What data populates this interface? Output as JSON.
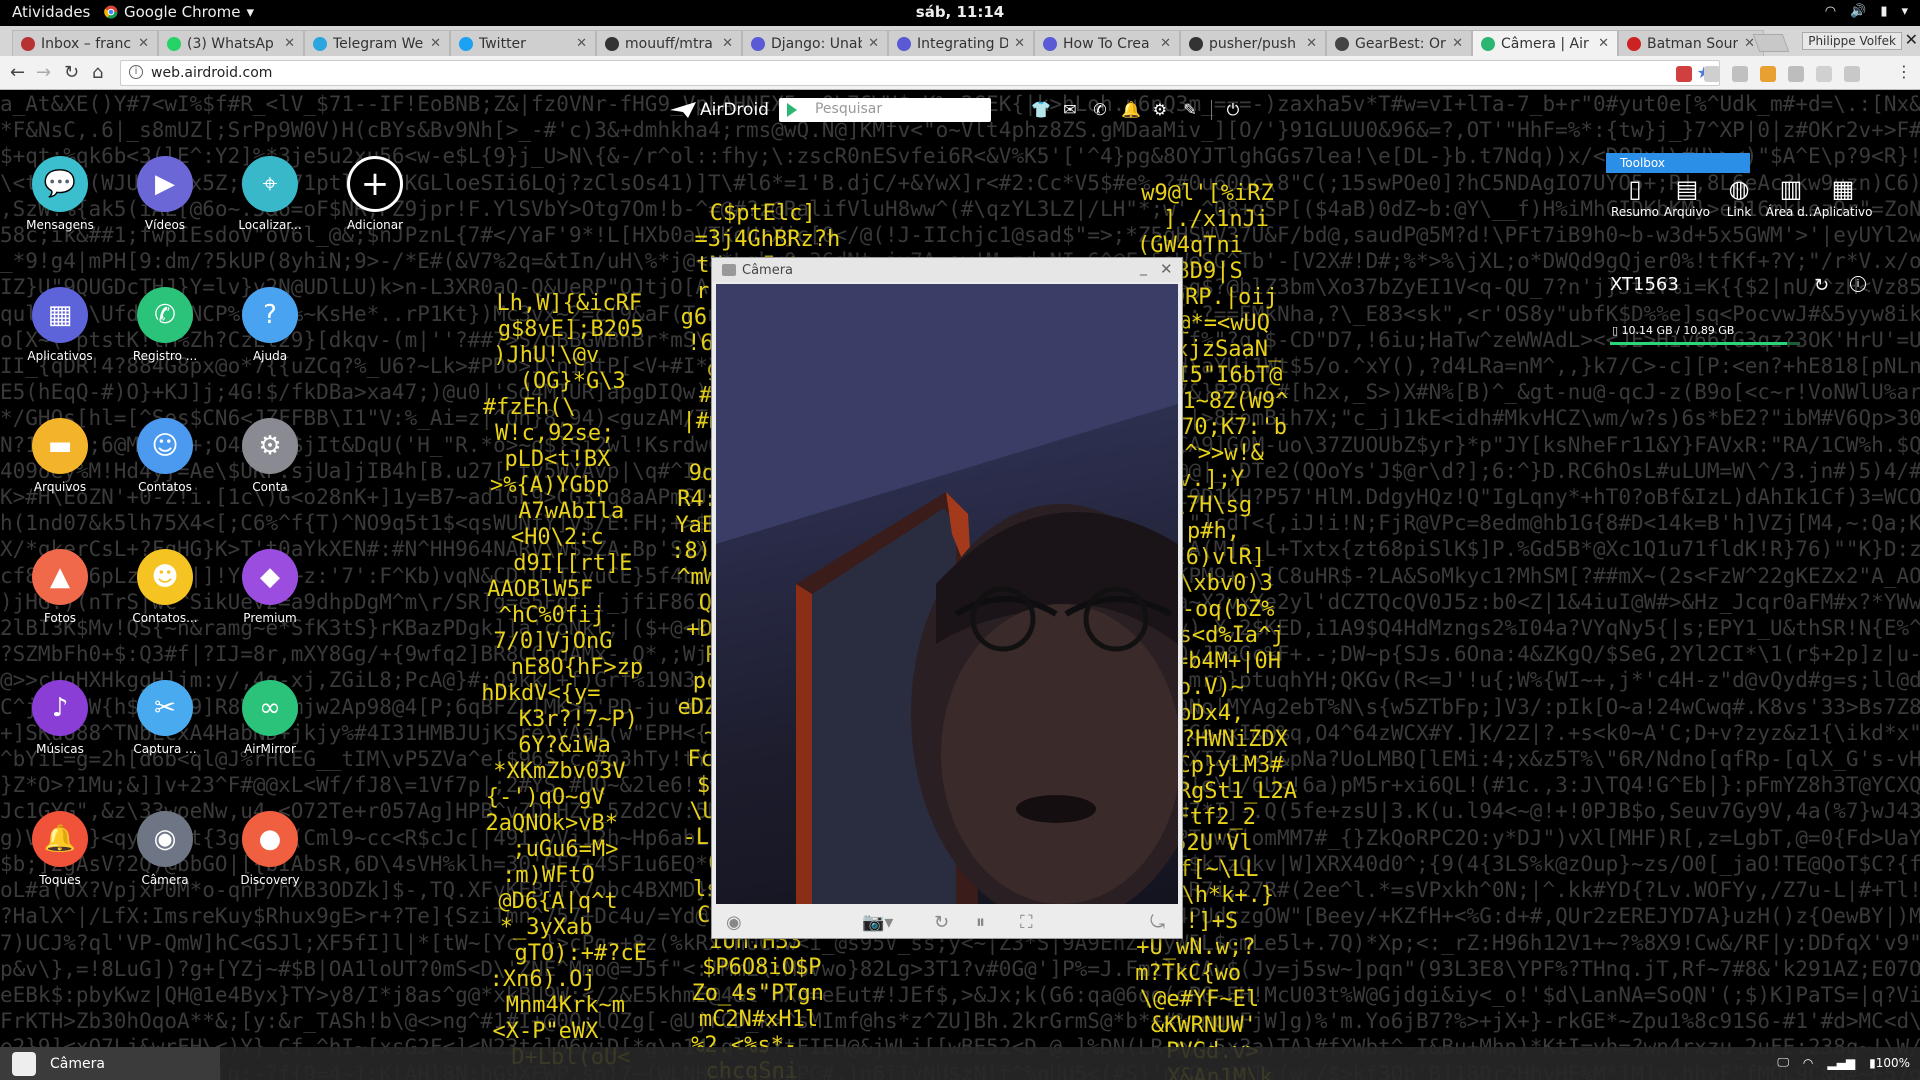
{
  "gnome": {
    "activities": "Atividades",
    "app_menu": "Google Chrome",
    "clock": "sáb, 11:14"
  },
  "tabs": [
    {
      "title": "Inbox – franc",
      "color": "#b73232"
    },
    {
      "title": "(3) WhatsAp",
      "color": "#25d366"
    },
    {
      "title": "Telegram We",
      "color": "#2ca5e0"
    },
    {
      "title": "Twitter",
      "color": "#1da1f2"
    },
    {
      "title": "mouuff/mtra",
      "color": "#333333"
    },
    {
      "title": "Django: Unab",
      "color": "#5a5ad6"
    },
    {
      "title": "Integrating D",
      "color": "#5a5ad6"
    },
    {
      "title": "How To Crea",
      "color": "#5a5ad6"
    },
    {
      "title": "pusher/push",
      "color": "#333333"
    },
    {
      "title": "GearBest: Or",
      "color": "#444444"
    },
    {
      "title": "Câmera | Air",
      "color": "#2bb673"
    },
    {
      "title": "Batman Sour",
      "color": "#cc2222"
    }
  ],
  "profile_name": "Philippe Volfek",
  "url": "web.airdroid.com",
  "airdroid": {
    "logo": "AirDroid",
    "search_placeholder": "Pesquisar"
  },
  "apps": [
    {
      "label": "Mensagens",
      "color": "#3bbfcf",
      "icon": "chat-icon"
    },
    {
      "label": "Vídeos",
      "color": "#6b67d6",
      "icon": "play-icon"
    },
    {
      "label": "Localizar...",
      "color": "#38b8c8",
      "icon": "location-pin-icon"
    },
    {
      "label": "Adicionar",
      "color": "#000000",
      "icon": "plus-icon"
    },
    {
      "label": "Aplicativos",
      "color": "#5d63d8",
      "icon": "grid-icon"
    },
    {
      "label": "Registro ...",
      "color": "#2bc27a",
      "icon": "phone-icon"
    },
    {
      "label": "Ajuda",
      "color": "#4aa3f0",
      "icon": "question-icon"
    },
    {
      "label": "Arquivos",
      "color": "#f3b32a",
      "icon": "folder-icon"
    },
    {
      "label": "Contatos",
      "color": "#4b9af0",
      "icon": "contact-icon"
    },
    {
      "label": "Conta",
      "color": "#8a8a92",
      "icon": "gear-icon"
    },
    {
      "label": "Fotos",
      "color": "#f0694a",
      "icon": "photo-icon"
    },
    {
      "label": "Contatos...",
      "color": "#f5c322",
      "icon": "contact-card-icon"
    },
    {
      "label": "Premium",
      "color": "#9b4de0",
      "icon": "diamond-icon"
    },
    {
      "label": "Músicas",
      "color": "#8b3ed6",
      "icon": "music-icon"
    },
    {
      "label": "Captura ...",
      "color": "#4aaaf0",
      "icon": "scissors-icon"
    },
    {
      "label": "AirMirror",
      "color": "#2bc27a",
      "icon": "binoculars-icon"
    },
    {
      "label": "Toques",
      "color": "#f0523a",
      "icon": "bell-icon"
    },
    {
      "label": "Câmera",
      "color": "#6e7585",
      "icon": "camera-icon"
    },
    {
      "label": "Discovery",
      "color": "#f06040",
      "icon": "planet-icon"
    }
  ],
  "toolbox": {
    "title": "Toolbox",
    "items": [
      {
        "label": "Resumo",
        "icon": "phone-device-icon"
      },
      {
        "label": "Arquivo",
        "icon": "document-icon"
      },
      {
        "label": "Link",
        "icon": "globe-icon"
      },
      {
        "label": "Área d...",
        "icon": "clipboard-icon"
      },
      {
        "label": "Aplicativo",
        "icon": "app-icon"
      }
    ],
    "device_name": "XT1563",
    "storage_text": "10.14 GB / 10.89 GB",
    "storage_fraction": 0.93
  },
  "camera_window": {
    "title": "Câmera"
  },
  "bottom_bar": {
    "task_label": "Câmera",
    "battery": "100%"
  }
}
